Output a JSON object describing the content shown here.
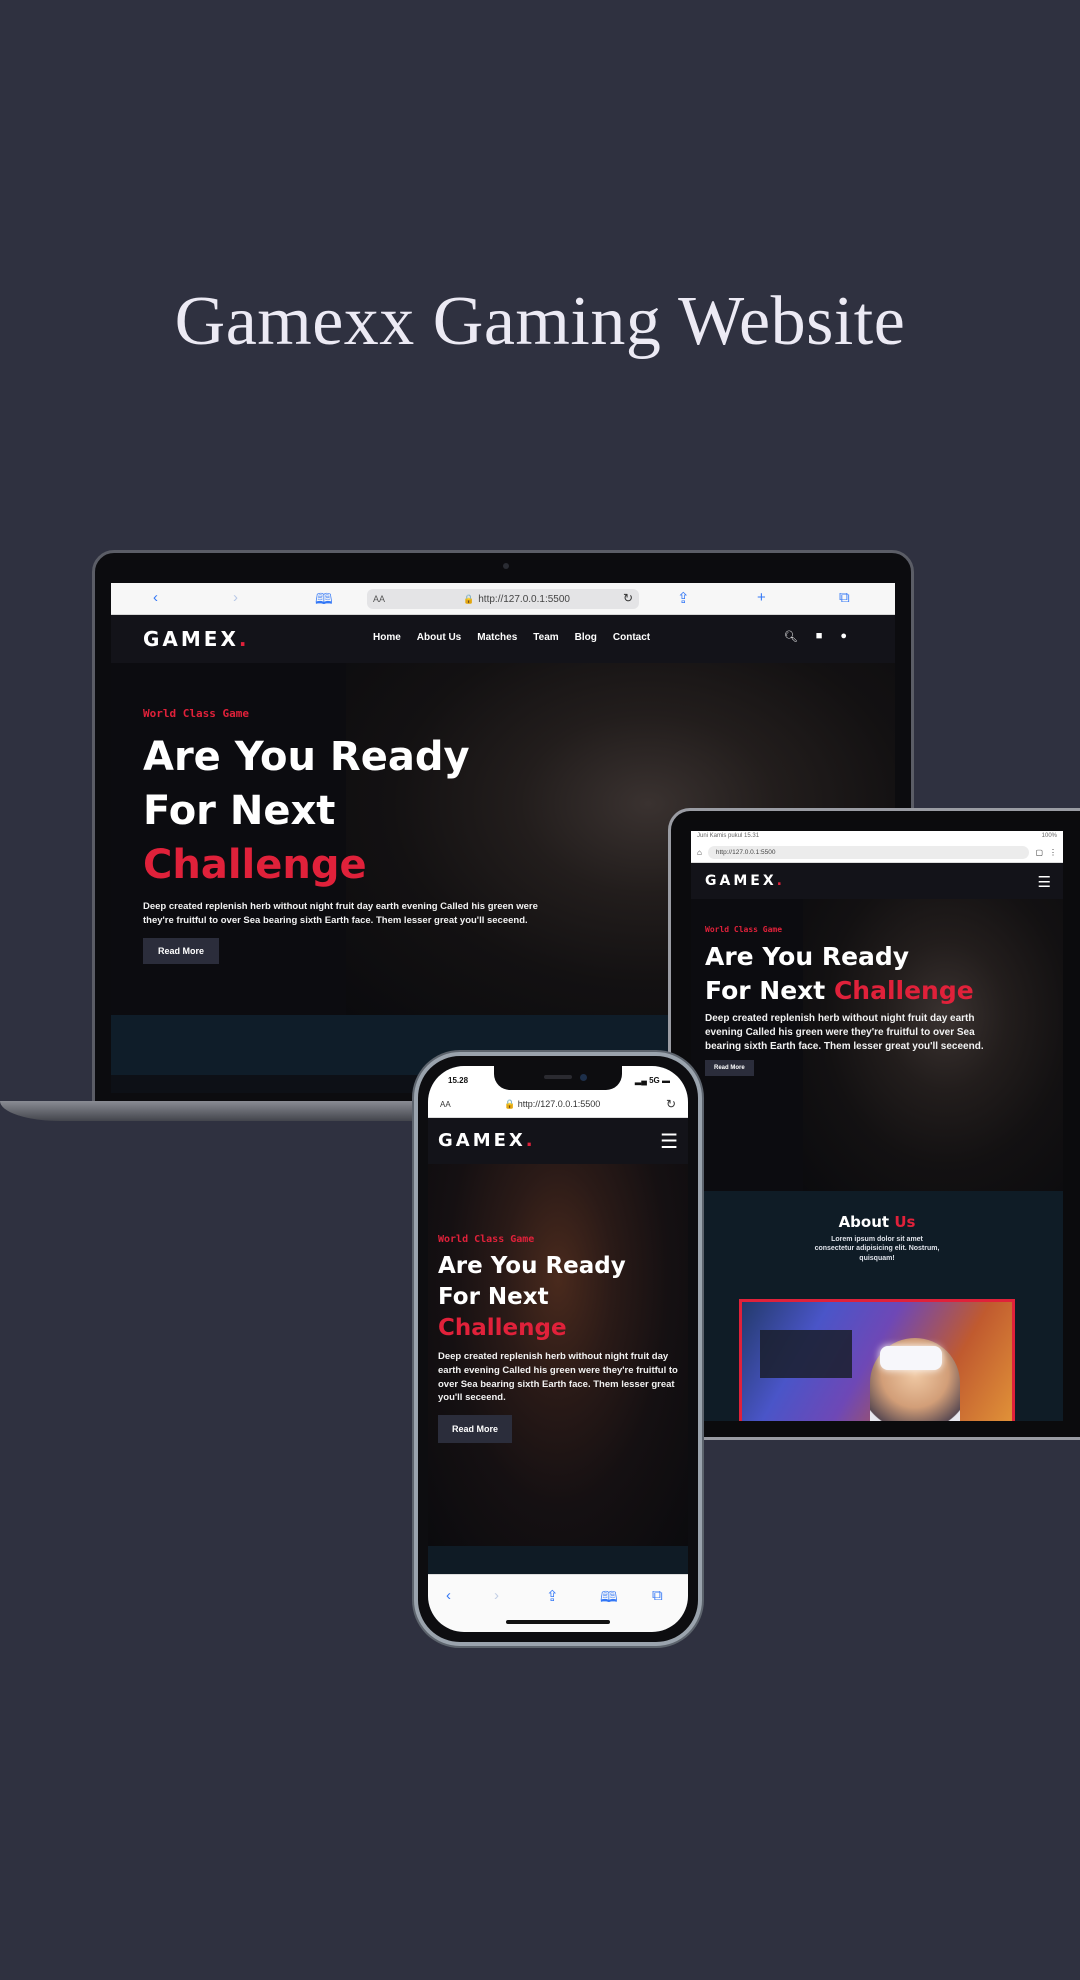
{
  "page": {
    "title": "Gamexx Gaming Website"
  },
  "site": {
    "logo": "GAMEX",
    "logo_dot": ".",
    "nav": [
      "Home",
      "About Us",
      "Matches",
      "Team",
      "Blog",
      "Contact"
    ],
    "kicker": "World Class Game",
    "headline_line1": "Are You Ready",
    "headline_line2_prefix": "For Next ",
    "headline_line2_accent": "Challenge",
    "lede": "Deep created replenish herb without night fruit day earth evening Called his green were they're fruitful to over Sea bearing sixth Earth face. Them lesser great you'll seceend.",
    "button": "Read More",
    "about_title_prefix": "About ",
    "about_title_accent": "Us",
    "about_text": "Lorem ipsum dolor sit amet consectetur adipisicing elit. Nostrum, quisquam!"
  },
  "laptop": {
    "url_aa": "AA",
    "url": "http://127.0.0.1:5500",
    "icons": [
      "back-icon",
      "forward-icon",
      "bookmarks-icon",
      "share-icon",
      "new-tab-icon",
      "tabs-icon"
    ]
  },
  "tablet": {
    "status_left": "Juni Kamis pukul 15.31",
    "status_right": "100%",
    "url": "http://127.0.0.1:5500"
  },
  "phone": {
    "time": "15.28",
    "signal": "5G",
    "url_aa": "AA",
    "url": "http://127.0.0.1:5500"
  },
  "colors": {
    "accent": "#e0213a",
    "background": "#2f3140",
    "nav": "#131319"
  }
}
